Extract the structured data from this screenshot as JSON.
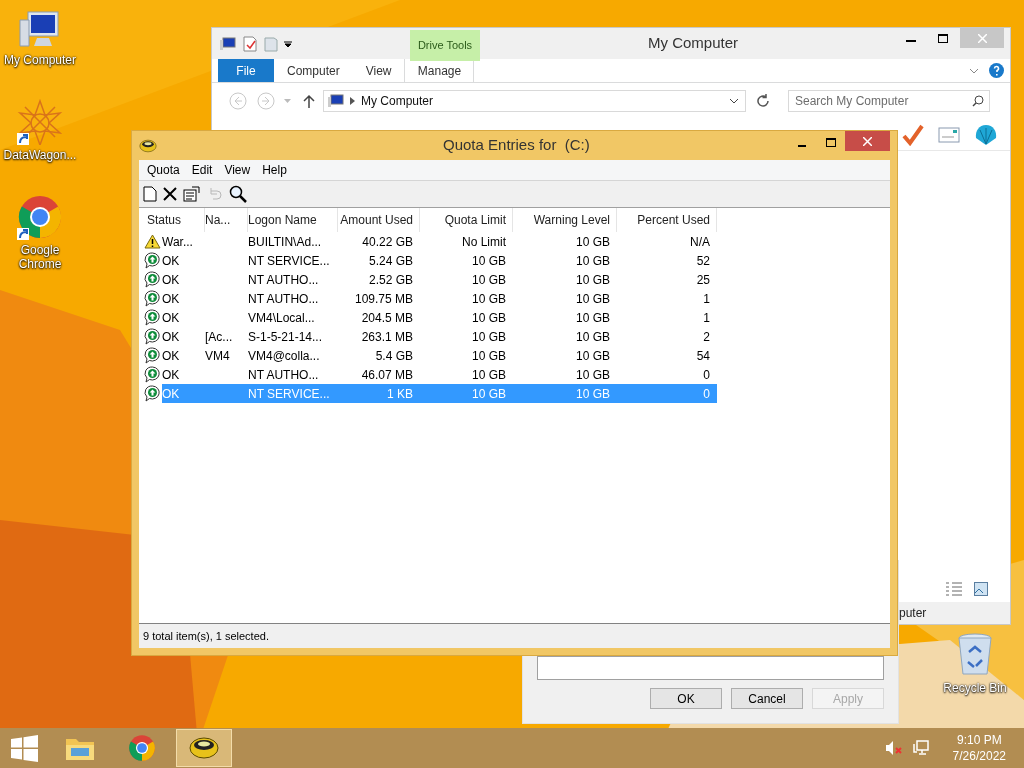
{
  "desktop_icons": [
    {
      "label": "My Computer",
      "kind": "computer",
      "shortcut": false
    },
    {
      "label": "DataWagon...",
      "kind": "star",
      "shortcut": true
    },
    {
      "label": "Google Chrome",
      "kind": "chrome",
      "shortcut": true
    },
    {
      "label": "Recycle Bin",
      "kind": "recycle",
      "shortcut": false
    }
  ],
  "explorer": {
    "title": "My Computer",
    "context_group": "Drive Tools",
    "tabs": [
      {
        "label": "File",
        "kind": "file"
      },
      {
        "label": "Computer",
        "kind": "tab"
      },
      {
        "label": "View",
        "kind": "tab"
      },
      {
        "label": "Manage",
        "kind": "context"
      }
    ],
    "address": "My Computer",
    "search": {
      "placeholder": "Search My Computer"
    },
    "status_text": "puter"
  },
  "dialog": {
    "buttons": [
      {
        "label": "OK",
        "disabled": false
      },
      {
        "label": "Cancel",
        "disabled": false
      },
      {
        "label": "Apply",
        "disabled": true
      }
    ]
  },
  "quota_window": {
    "title": "Quota Entries for  (C:)",
    "menu": [
      "Quota",
      "Edit",
      "View",
      "Help"
    ],
    "toolbar": [
      {
        "kind": "new",
        "disabled": false
      },
      {
        "kind": "delete",
        "disabled": false
      },
      {
        "kind": "properties",
        "disabled": false
      },
      {
        "kind": "undo",
        "disabled": true
      },
      {
        "kind": "find",
        "disabled": false
      }
    ],
    "columns": [
      "Status",
      "Na...",
      "Logon Name",
      "Amount Used",
      "Quota Limit",
      "Warning Level",
      "Percent Used"
    ],
    "rows": [
      {
        "kind": "warning",
        "status": "War...",
        "logon": "BUILTIN\\Ad...",
        "amount": "40.22 GB",
        "limit": "No Limit",
        "warning": "10 GB",
        "percent": "N/A",
        "selected": false
      },
      {
        "kind": "ok",
        "status": "OK",
        "logon": "NT SERVICE...",
        "amount": "5.24 GB",
        "limit": "10 GB",
        "warning": "10 GB",
        "percent": "52",
        "selected": false
      },
      {
        "kind": "ok",
        "status": "OK",
        "logon": "NT AUTHO...",
        "amount": "2.52 GB",
        "limit": "10 GB",
        "warning": "10 GB",
        "percent": "25",
        "selected": false
      },
      {
        "kind": "ok",
        "status": "OK",
        "logon": "NT AUTHO...",
        "amount": "109.75 MB",
        "limit": "10 GB",
        "warning": "10 GB",
        "percent": "1",
        "selected": false
      },
      {
        "kind": "ok",
        "status": "OK",
        "logon": "VM4\\Local...",
        "amount": "204.5 MB",
        "limit": "10 GB",
        "warning": "10 GB",
        "percent": "1",
        "selected": false
      },
      {
        "kind": "ok",
        "status": "OK",
        "name": "[Ac...",
        "logon": "S-1-5-21-14...",
        "amount": "263.1 MB",
        "limit": "10 GB",
        "warning": "10 GB",
        "percent": "2",
        "selected": false
      },
      {
        "kind": "ok",
        "status": "OK",
        "name": "VM4",
        "logon": "VM4@colla...",
        "amount": "5.4 GB",
        "limit": "10 GB",
        "warning": "10 GB",
        "percent": "54",
        "selected": false
      },
      {
        "kind": "ok",
        "status": "OK",
        "logon": "NT AUTHO...",
        "amount": "46.07 MB",
        "limit": "10 GB",
        "warning": "10 GB",
        "percent": "0",
        "selected": false
      },
      {
        "kind": "ok",
        "status": "OK",
        "logon": "NT SERVICE...",
        "amount": "1 KB",
        "limit": "10 GB",
        "warning": "10 GB",
        "percent": "0",
        "selected": true
      }
    ],
    "status_bar": "9 total item(s), 1 selected."
  },
  "taskbar": {
    "apps": [
      {
        "kind": "explorer",
        "active": false
      },
      {
        "kind": "chrome",
        "active": false
      },
      {
        "kind": "quota",
        "active": true
      }
    ],
    "sound_muted": true,
    "time": "9:10 PM",
    "date": "7/26/2022"
  }
}
